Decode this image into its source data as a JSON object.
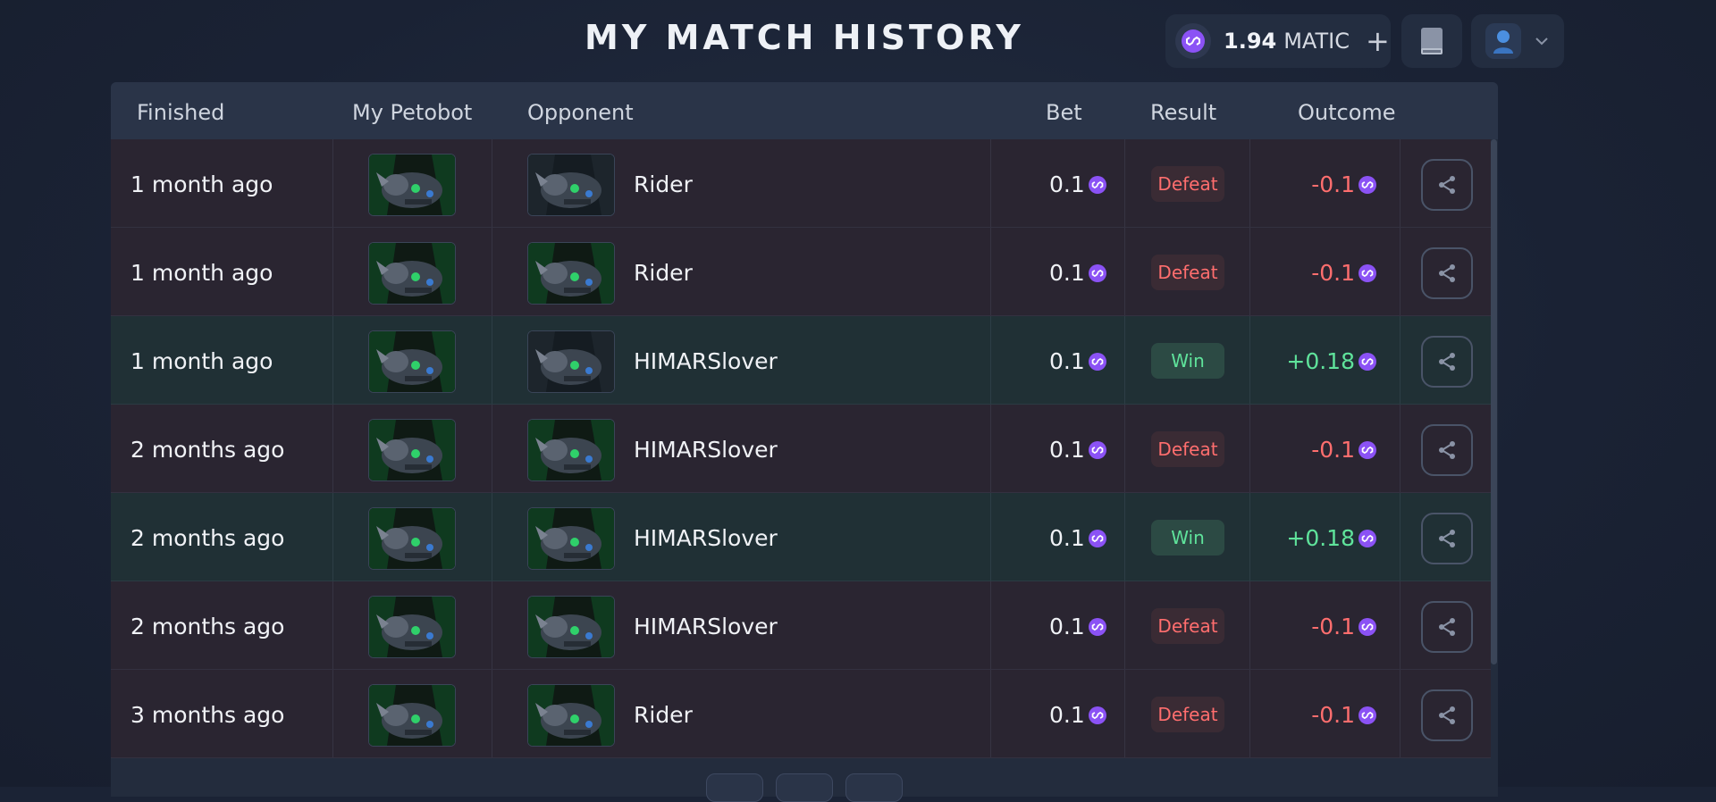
{
  "header": {
    "title": "My Match History",
    "wallet": {
      "amount": "1.94",
      "unit": "MATIC",
      "add_label": "+"
    }
  },
  "table": {
    "columns": [
      "Finished",
      "My Petobot",
      "Opponent",
      "Bet",
      "Result",
      "Outcome"
    ],
    "rows": [
      {
        "finished": "1 month ago",
        "opponent": "Rider",
        "bet": "0.1",
        "result": "Defeat",
        "outcome": "-0.1",
        "status": "loss"
      },
      {
        "finished": "1 month ago",
        "opponent": "Rider",
        "bet": "0.1",
        "result": "Defeat",
        "outcome": "-0.1",
        "status": "loss"
      },
      {
        "finished": "1 month ago",
        "opponent": "HIMARSlover",
        "bet": "0.1",
        "result": "Win",
        "outcome": "+0.18",
        "status": "win"
      },
      {
        "finished": "2 months ago",
        "opponent": "HIMARSlover",
        "bet": "0.1",
        "result": "Defeat",
        "outcome": "-0.1",
        "status": "loss"
      },
      {
        "finished": "2 months ago",
        "opponent": "HIMARSlover",
        "bet": "0.1",
        "result": "Win",
        "outcome": "+0.18",
        "status": "win"
      },
      {
        "finished": "2 months ago",
        "opponent": "HIMARSlover",
        "bet": "0.1",
        "result": "Defeat",
        "outcome": "-0.1",
        "status": "loss"
      },
      {
        "finished": "3 months ago",
        "opponent": "Rider",
        "bet": "0.1",
        "result": "Defeat",
        "outcome": "-0.1",
        "status": "loss"
      }
    ]
  },
  "icons": {
    "coin": "matic-coin-icon",
    "share": "share-icon",
    "book": "book-icon",
    "avatar": "user-avatar-icon",
    "chevron": "chevron-down-icon"
  },
  "colors": {
    "loss": "#ff6e6e",
    "win": "#5fe39b",
    "matic": "#8b52f5"
  }
}
